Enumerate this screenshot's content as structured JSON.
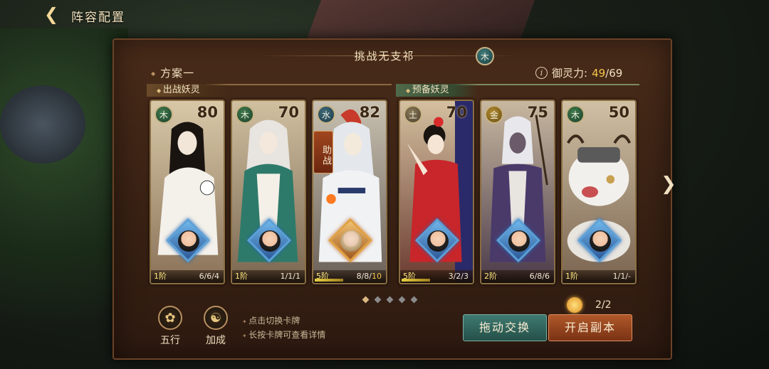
{
  "header": {
    "title": "阵容配置"
  },
  "challenge": {
    "title": "挑战无支祁",
    "element": "木"
  },
  "plan": {
    "name": "方案一"
  },
  "power": {
    "label": "御灵力:",
    "current": "49",
    "separator": "/",
    "max": "69"
  },
  "sections": {
    "active": "出战妖灵",
    "reserve": "预备妖灵"
  },
  "cards": [
    {
      "element": "木",
      "level": "80",
      "rank": "1阶",
      "stats": "6/6/4",
      "stats_hi": ""
    },
    {
      "element": "木",
      "level": "70",
      "rank": "1阶",
      "stats": "1/1/1",
      "stats_hi": ""
    },
    {
      "element": "水",
      "level": "82",
      "rank": "5阶",
      "stats": "8/8/",
      "stats_hi": "10"
    },
    {
      "element": "土",
      "level": "70",
      "rank": "5阶",
      "stats": "3/2/3",
      "stats_hi": ""
    },
    {
      "element": "金",
      "level": "75",
      "rank": "2阶",
      "stats": "6/8/6",
      "stats_hi": ""
    },
    {
      "element": "木",
      "level": "50",
      "rank": "1阶",
      "stats": "1/1/-",
      "stats_hi": ""
    }
  ],
  "assist_tag": "助战",
  "pagination": {
    "total": 5,
    "active": 0
  },
  "bottom": {
    "wuxing_label": "五行",
    "jiacheng_label": "加成",
    "tip1": "点击切换卡牌",
    "tip2": "长按卡牌可查看详情",
    "sun_count": "2/2",
    "swap_label": "拖动交换",
    "start_label": "开启副本"
  },
  "colors": {
    "wood": "#3f7a4e",
    "water": "#3f6a7a",
    "earth": "#8a7a5a",
    "metal": "#b08a30",
    "power_current": "#f4c84a"
  }
}
